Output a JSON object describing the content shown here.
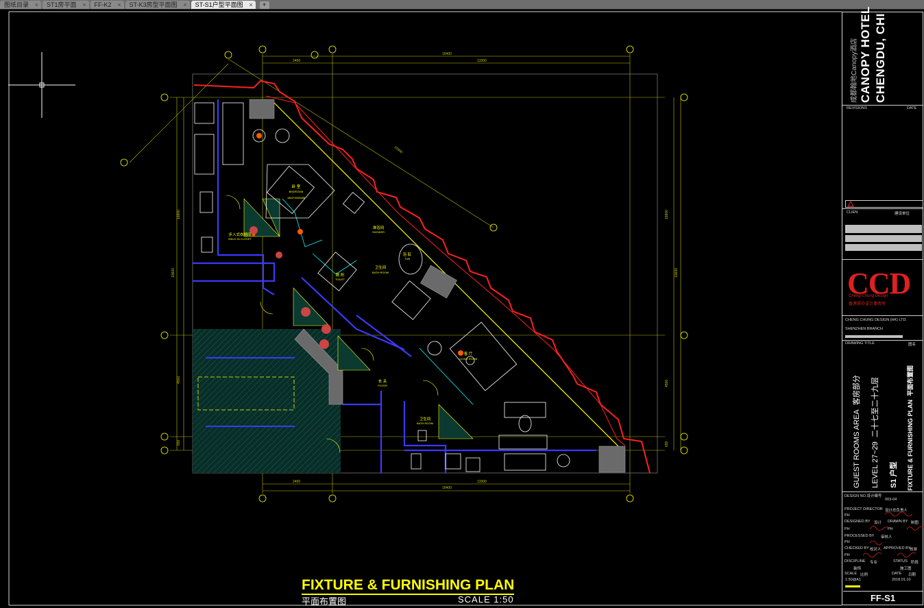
{
  "tabs": [
    {
      "label": "图纸目录"
    },
    {
      "label": "ST1房平面"
    },
    {
      "label": "FF-K2"
    },
    {
      "label": "ST-K3房型平面图"
    },
    {
      "label": "ST-S1户型平面图"
    }
  ],
  "tab_close_glyph": "×",
  "tab_add_glyph": "+",
  "drawing": {
    "title": "FIXTURE & FURNISHING PLAN",
    "title_cn": "平面布置图",
    "scale": "SCALE 1:50",
    "dims_top": [
      "16400",
      "2400",
      "13300"
    ],
    "dims_bottom": [
      "16400",
      "2400",
      "13300"
    ],
    "dims_right": [
      "16800",
      "10600",
      "4500",
      "650"
    ],
    "dims_left": [
      "16800",
      "10600",
      "4500",
      "650"
    ],
    "dim_diag": "15800",
    "rooms": {
      "bedroom": "卧 室",
      "bedroom_en": "BEDROOM",
      "bed_size": "1800*2000MM",
      "bathroom": "卫生间",
      "bathroom_en": "BATH ROOM",
      "living": "客 厅",
      "living_en": "LIVING ROOM",
      "shower": "淋浴间",
      "shower_en": "SHOWER",
      "toilet": "厕 所",
      "toilet_en": "TOILET",
      "bathroom2": "卫生间",
      "bathroom2_en": "BATH ROOM",
      "entry": "玄 关",
      "entry_en": "FOYER",
      "closet": "步入式衣帽间",
      "closet_en": "WALK-IN CLOSET",
      "tub": "浴 缸",
      "tub_en": "TUB"
    }
  },
  "title_block": {
    "project_cn": "成都翰地Canopy酒店",
    "project_en1": "CANOPY HOTEL",
    "project_en2": "CHENGDU, CHI",
    "revisions": "REVISIONS",
    "date": "DATE",
    "client": "CLIEN",
    "client_cn": "建设单位",
    "company": "CCD",
    "company_sub1": "Cheng Chung Design",
    "company_sub2": "香港郑中设计事务所",
    "company_info1": "CHENG CHUNG DESIGN (HK) LTD.",
    "company_info2": "SHENZHEN BRANCH",
    "drawing_title": "DRAWING TITLE",
    "drawing_title_cn": "图名",
    "area": "GUEST ROOMS AREA",
    "area_cn": "客房部分",
    "level": "LEVEL 27~29",
    "level_cn": "二十七至二十九层",
    "unit": "S1 户型",
    "plan_name": "FIXTURE & FURNISHING PLAN",
    "plan_name_cn": "平面布置图",
    "design_no": "DESIGN NO.设计编号",
    "design_no_val": "003-04",
    "project_director": "PROJECT DIRECTOR",
    "project_director_cn": "设计总负责人",
    "designed_by": "DESIGNED BY",
    "designed_by_cn": "设计",
    "drawn_by": "DRAWN BY",
    "drawn_by_cn": "制图",
    "processed_by": "PROCESSED BY",
    "processed_by_cn": "审核人",
    "checked_by": "CHECKED BY",
    "checked_by_cn": "校对人",
    "approved_by": "APPROVED BY",
    "approved_by_cn": "核准",
    "discipline": "DISCIPLINE",
    "discipline_cn": "专业",
    "discipline_val": "装饰",
    "status": "STATUS",
    "status_cn": "阶段",
    "status_val": "施工图",
    "scale_lbl": "SCALE",
    "scale_cn": "比例",
    "scale_val": "1:50@A1",
    "date_lbl": "DATE",
    "date_cn": "日期",
    "date_val": "2018.01.10",
    "ph": "PH",
    "sheet": "FF-S1"
  },
  "colors": {
    "background": "#000000",
    "wall_red": "#ff2020",
    "furniture_white": "#ffffff",
    "accent_yellow": "#ffff00",
    "dim_green": "#c8c800",
    "cyan": "#00ffff",
    "blue": "#3a3aff",
    "teal_fill": "#0b3a30",
    "brand_red": "#e02020"
  }
}
